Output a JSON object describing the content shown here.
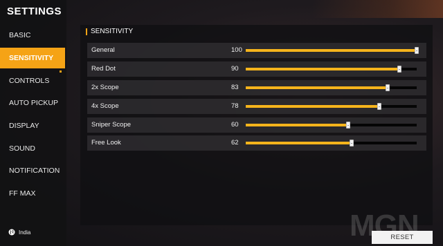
{
  "sidebar": {
    "title": "SETTINGS",
    "items": [
      {
        "label": "BASIC",
        "active": false
      },
      {
        "label": "SENSITIVITY",
        "active": true
      },
      {
        "label": "CONTROLS",
        "active": false
      },
      {
        "label": "AUTO PICKUP",
        "active": false
      },
      {
        "label": "DISPLAY",
        "active": false
      },
      {
        "label": "SOUND",
        "active": false
      },
      {
        "label": "NOTIFICATION",
        "active": false
      },
      {
        "label": "FF MAX",
        "active": false
      }
    ],
    "region": "India",
    "region_icon": "globe-icon"
  },
  "panel": {
    "header": "SENSITIVITY",
    "rows": [
      {
        "label": "General",
        "value": "100",
        "fraction": 1.0
      },
      {
        "label": "Red Dot",
        "value": "90",
        "fraction": 0.9
      },
      {
        "label": "2x Scope",
        "value": "83",
        "fraction": 0.83
      },
      {
        "label": "4x Scope",
        "value": "78",
        "fraction": 0.78
      },
      {
        "label": "Sniper Scope",
        "value": "60",
        "fraction": 0.6
      },
      {
        "label": "Free Look",
        "value": "62",
        "fraction": 0.62
      }
    ]
  },
  "footer": {
    "reset_label": "RESET",
    "watermark": "MGN"
  },
  "colors": {
    "accent": "#f5a316",
    "slider_fill": "#f5b41c"
  }
}
